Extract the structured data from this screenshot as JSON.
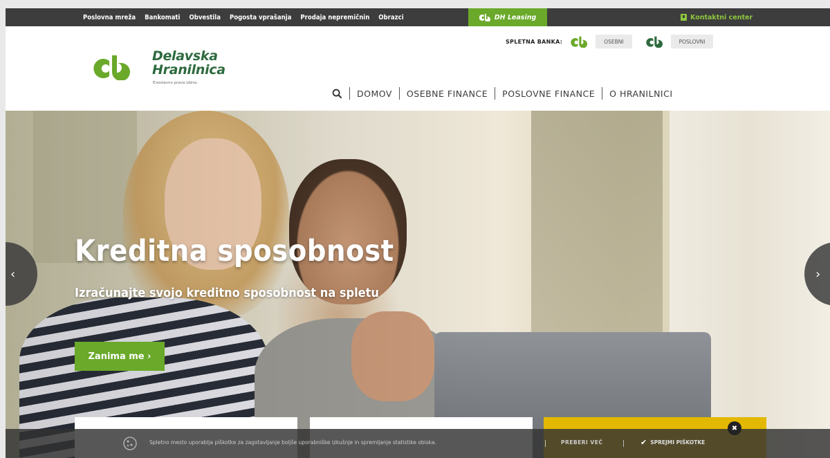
{
  "topbar": {
    "links": [
      "Poslovna mreža",
      "Bankomati",
      "Obvestila",
      "Pogosta vprašanja",
      "Prodaja nepremičnin",
      "Obrazci"
    ],
    "leasing_label": "DH Leasing",
    "contact_label": "Kontaktni center"
  },
  "header": {
    "logo_line1": "Delavska",
    "logo_line2": "Hranilnica",
    "slogan": "Enostavno prava izbira.",
    "ebank_label": "SPLETNA BANKA:",
    "ebank_personal": "OSEBNI",
    "ebank_business": "POSLOVNI",
    "nav": [
      "DOMOV",
      "OSEBNE FINANCE",
      "POSLOVNE FINANCE",
      "O HRANILNICI"
    ]
  },
  "hero": {
    "title": "Kreditna sposobnost",
    "subtitle": "Izračunajte svojo kreditno sposobnost na spletu",
    "cta": "Zanima me ›",
    "prev": "‹",
    "next": "›"
  },
  "cookie": {
    "text": "Spletno mesto uporablja piškotke za zagotavljanje boljše uporabniške izkušnje in spremljanje statistike obiska.",
    "more": "PREBERI VEČ",
    "accept": "SPREJMI PIŠKOTKE",
    "close": "✖"
  },
  "colors": {
    "brand_green": "#6aa92a",
    "logo_green": "#2d6a3e",
    "topbar": "#3d3d3d",
    "accent_yellow": "#e3b800"
  }
}
